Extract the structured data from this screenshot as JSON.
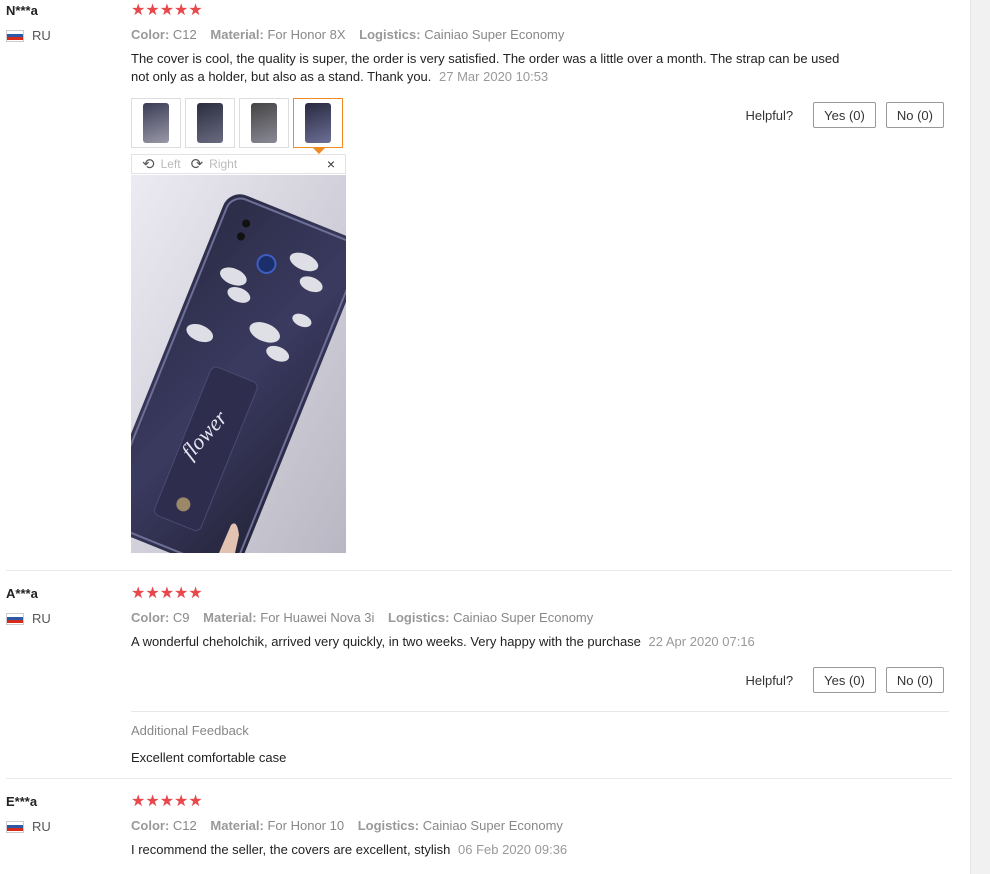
{
  "reviews": [
    {
      "user": "N***a",
      "country": "RU",
      "stars": "★★★★★",
      "color_label": "Color:",
      "color": "C12",
      "material_label": "Material:",
      "material": "For Honor 8X",
      "logistics_label": "Logistics:",
      "logistics": "Cainiao Super Economy",
      "text": "The cover is cool, the quality is super, the order is very satisfied. The order was a little over a month. The strap can be used not only as a holder, but also as a stand. Thank you.",
      "date": "27 Mar 2020 10:53",
      "helpful_label": "Helpful?",
      "yes_label": "Yes (0)",
      "no_label": "No (0)",
      "viewer": {
        "left_label": "Left",
        "right_label": "Right",
        "close": "×"
      },
      "photo_text": "flower"
    },
    {
      "user": "A***a",
      "country": "RU",
      "stars": "★★★★★",
      "color_label": "Color:",
      "color": "C9",
      "material_label": "Material:",
      "material": "For Huawei Nova 3i",
      "logistics_label": "Logistics:",
      "logistics": "Cainiao Super Economy",
      "text": "A wonderful cheholchik, arrived very quickly, in two weeks. Very happy with the purchase",
      "date": "22 Apr 2020 07:16",
      "helpful_label": "Helpful?",
      "yes_label": "Yes (0)",
      "no_label": "No (0)",
      "additional_title": "Additional Feedback",
      "additional_text": "Excellent comfortable case"
    },
    {
      "user": "E***a",
      "country": "RU",
      "stars": "★★★★★",
      "color_label": "Color:",
      "color": "C12",
      "material_label": "Material:",
      "material": "For Honor 10",
      "logistics_label": "Logistics:",
      "logistics": "Cainiao Super Economy",
      "text": "I recommend the seller, the covers are excellent, stylish",
      "date": "06 Feb 2020 09:36"
    }
  ],
  "colors": {
    "star": "#e8484b",
    "active_thumb": "#f08a24"
  }
}
